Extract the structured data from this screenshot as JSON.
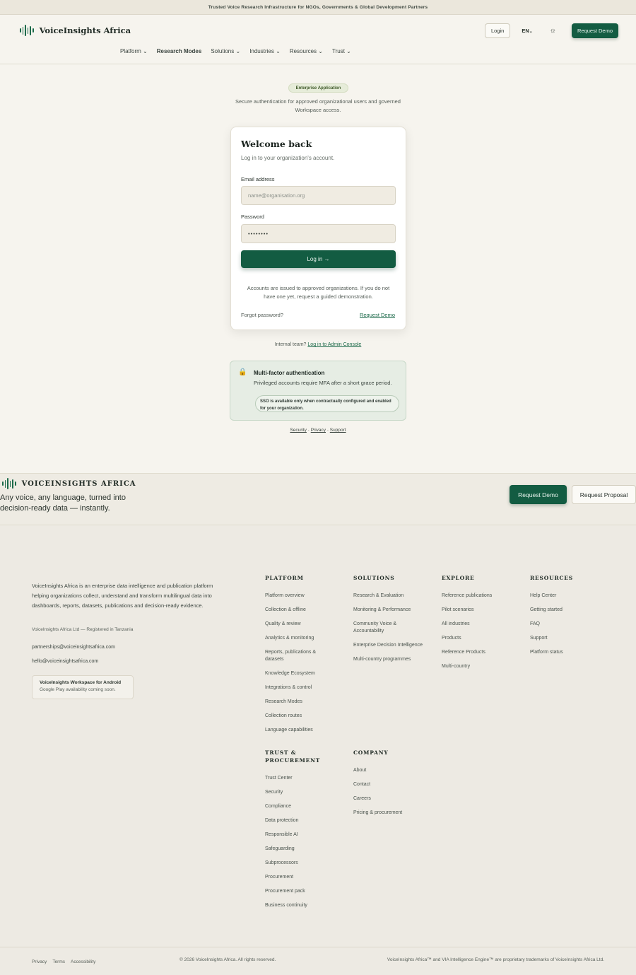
{
  "topbar": {
    "text": "Trusted Voice Research Infrastructure for NGOs, Governments & Global Development Partners"
  },
  "header": {
    "brand": "VoiceInsights Africa",
    "login": "Login",
    "lang": "EN",
    "theme_icon": "sun-icon",
    "request_demo": "Request Demo",
    "nav": [
      {
        "label": "Platform",
        "dropdown": true
      },
      {
        "label": "Research Modes",
        "dropdown": false
      },
      {
        "label": "Solutions",
        "dropdown": true
      },
      {
        "label": "Industries",
        "dropdown": true
      },
      {
        "label": "Resources",
        "dropdown": true
      },
      {
        "label": "Trust",
        "dropdown": true
      }
    ]
  },
  "intro": {
    "badge": "Enterprise Application",
    "text": "Secure authentication for approved organizational users and governed Workspace access."
  },
  "login_card": {
    "title": "Welcome back",
    "subtitle": "Log in to your organization's account.",
    "email_label": "Email address",
    "email_placeholder": "name@organisation.org",
    "password_label": "Password",
    "password_value": "••••••••",
    "submit": "Log in →",
    "note": "Accounts are issued to approved organizations. If you do not have one yet, request a guided demonstration.",
    "forgot": "Forgot password?",
    "request_demo": "Request Demo"
  },
  "internal": {
    "prefix": "Internal team?",
    "link": "Log in to Admin Console"
  },
  "mfa": {
    "title": "Multi-factor authentication",
    "body": "Privileged accounts require MFA after a short grace period.",
    "sso": "SSO is available only when contractually configured and enabled for your organization."
  },
  "security_links": {
    "security": "Security",
    "privacy": "Privacy",
    "support": "Support",
    "sep": "·"
  },
  "cta": {
    "brand": "VOICEINSIGHTS AFRICA",
    "tagline": "Any voice, any language, turned into decision-ready data — instantly.",
    "demo": "Request Demo",
    "proposal": "Request Proposal"
  },
  "footer": {
    "description": "VoiceInsights Africa is an enterprise data intelligence and publication platform helping organizations collect, understand and transform multilingual data into dashboards, reports, datasets, publications and decision-ready evidence.",
    "registered": "VoiceInsights Africa Ltd — Registered in Tanzania",
    "email_partnerships": "partnerships@voiceinsightsafrica.com",
    "email_hello": "hello@voiceinsightsafrica.com",
    "android_title": "VoiceInsights Workspace for Android",
    "android_sub": "Google Play availability coming soon.",
    "columns": {
      "platform": {
        "title": "PLATFORM",
        "items": [
          "Platform overview",
          "Collection & offline",
          "Quality & review",
          "Analytics & monitoring",
          "Reports, publications & datasets",
          "Knowledge Ecosystem",
          "Integrations & control",
          "Research Modes",
          "Collection routes",
          "Language capabilities"
        ]
      },
      "solutions": {
        "title": "SOLUTIONS",
        "items": [
          "Research & Evaluation",
          "Monitoring & Performance",
          "Community Voice & Accountability",
          "Enterprise Decision Intelligence",
          "Multi-country programmes"
        ]
      },
      "explore": {
        "title": "EXPLORE",
        "items": [
          "Reference publications",
          "Pilot scenarios",
          "All industries",
          "Products",
          "Reference Products",
          "Multi-country"
        ]
      },
      "resources": {
        "title": "RESOURCES",
        "items": [
          "Help Center",
          "Getting started",
          "FAQ",
          "Support",
          "Platform status"
        ]
      },
      "trust": {
        "title": "TRUST & PROCUREMENT",
        "items": [
          "Trust Center",
          "Security",
          "Compliance",
          "Data protection",
          "Responsible AI",
          "Safeguarding",
          "Subprocessors",
          "Procurement",
          "Procurement pack",
          "Business continuity"
        ]
      },
      "company": {
        "title": "COMPANY",
        "items": [
          "About",
          "Contact",
          "Careers",
          "Pricing & procurement"
        ]
      }
    },
    "bottom": {
      "privacy": "Privacy",
      "terms": "Terms",
      "accessibility": "Accessibility",
      "copyright": "© 2026 VoiceInsights Africa. All rights reserved.",
      "trademark": "VoiceInsights Africa™ and VIA Intelligence Engine™ are proprietary trademarks of VoiceInsights Africa Ltd."
    }
  }
}
